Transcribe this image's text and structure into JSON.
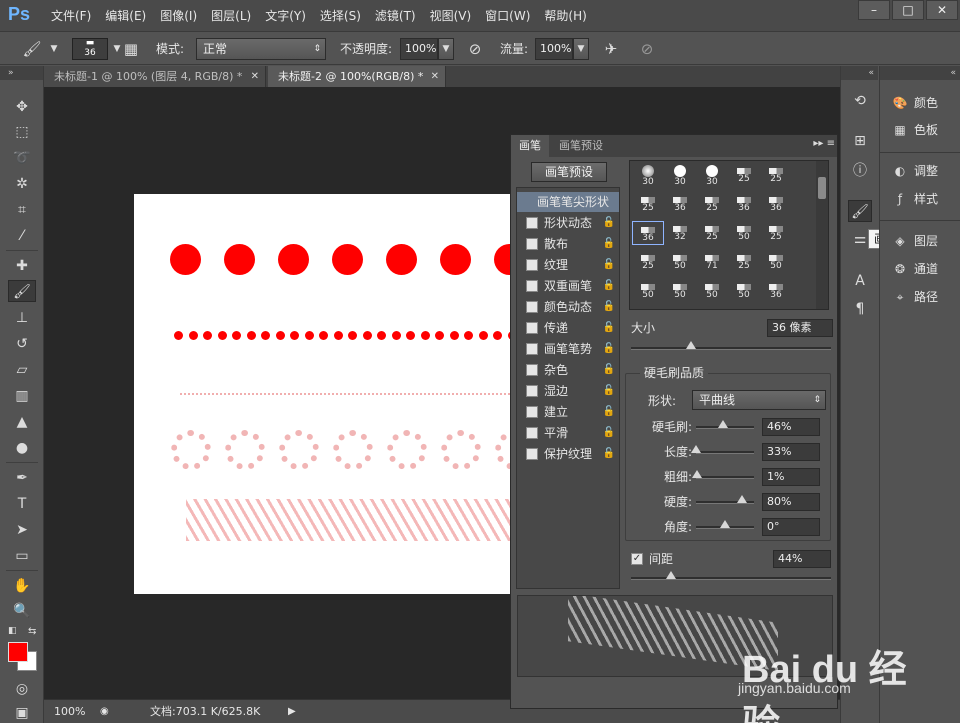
{
  "app": {
    "logo": "Ps",
    "menus": [
      "文件(F)",
      "编辑(E)",
      "图像(I)",
      "图层(L)",
      "文字(Y)",
      "选择(S)",
      "滤镜(T)",
      "视图(V)",
      "窗口(W)",
      "帮助(H)"
    ],
    "window_controls": [
      "minimize-icon",
      "maximize-icon",
      "close-icon"
    ]
  },
  "options_bar": {
    "brush_size": "36",
    "mode_label": "模式:",
    "mode_value": "正常",
    "opacity_label": "不透明度:",
    "opacity_value": "100%",
    "flow_label": "流量:",
    "flow_value": "100%"
  },
  "tabs": [
    {
      "label": "未标题-1 @ 100% (图层 4, RGB/8) *",
      "active": false
    },
    {
      "label": "未标题-2 @ 100%(RGB/8) *",
      "active": true
    }
  ],
  "status_bar": {
    "zoom": "100%",
    "doc_info": "文档:703.1 K/625.8K"
  },
  "colors": {
    "foreground": "#ff0000",
    "background": "#ffffff",
    "brush_red": "#ff0000"
  },
  "brush_panel": {
    "tabs": [
      "画笔",
      "画笔预设"
    ],
    "preset_button": "画笔预设",
    "list": [
      {
        "label": "画笔笔尖形状",
        "selected": true,
        "checkbox": false,
        "lock": false
      },
      {
        "label": "形状动态",
        "selected": false,
        "checkbox": true,
        "lock": true
      },
      {
        "label": "散布",
        "selected": false,
        "checkbox": true,
        "lock": true
      },
      {
        "label": "纹理",
        "selected": false,
        "checkbox": true,
        "lock": true
      },
      {
        "label": "双重画笔",
        "selected": false,
        "checkbox": true,
        "lock": true
      },
      {
        "label": "颜色动态",
        "selected": false,
        "checkbox": true,
        "lock": true
      },
      {
        "label": "传递",
        "selected": false,
        "checkbox": true,
        "lock": true
      },
      {
        "label": "画笔笔势",
        "selected": false,
        "checkbox": true,
        "lock": true
      },
      {
        "label": "杂色",
        "selected": false,
        "checkbox": true,
        "lock": true
      },
      {
        "label": "湿边",
        "selected": false,
        "checkbox": true,
        "lock": true
      },
      {
        "label": "建立",
        "selected": false,
        "checkbox": true,
        "lock": true
      },
      {
        "label": "平滑",
        "selected": false,
        "checkbox": true,
        "lock": true
      },
      {
        "label": "保护纹理",
        "selected": false,
        "checkbox": true,
        "lock": true
      }
    ],
    "tips": [
      "30",
      "30",
      "30",
      "25",
      "25",
      "25",
      "36",
      "25",
      "36",
      "36",
      "36",
      "32",
      "25",
      "50",
      "25",
      "25",
      "50",
      "71",
      "25",
      "50",
      "50",
      "50",
      "50",
      "50",
      "36"
    ],
    "selected_tip_index": 10,
    "size_label": "大小",
    "size_value": "36 像素",
    "size_fraction": 0.3,
    "bristle_title": "硬毛刷品质",
    "shape_label": "形状:",
    "shape_value": "平曲线",
    "params": [
      {
        "label": "硬毛刷:",
        "value": "46%",
        "fraction": 0.46
      },
      {
        "label": "长度:",
        "value": "33%",
        "fraction": 0.0
      },
      {
        "label": "粗细:",
        "value": "1%",
        "fraction": 0.01
      },
      {
        "label": "硬度:",
        "value": "80%",
        "fraction": 0.8
      },
      {
        "label": "角度:",
        "value": "0°",
        "fraction": 0.5
      }
    ],
    "spacing_label": "间距",
    "spacing_value": "44%",
    "spacing_checked": true,
    "spacing_fraction": 0.2
  },
  "right_dock": {
    "tooltip": "画笔"
  },
  "right_panels": [
    "颜色",
    "色板",
    "调整",
    "样式",
    "图层",
    "通道",
    "路径"
  ],
  "watermark": {
    "text": "Bai du 经验",
    "sub": "jingyan.baidu.com"
  }
}
